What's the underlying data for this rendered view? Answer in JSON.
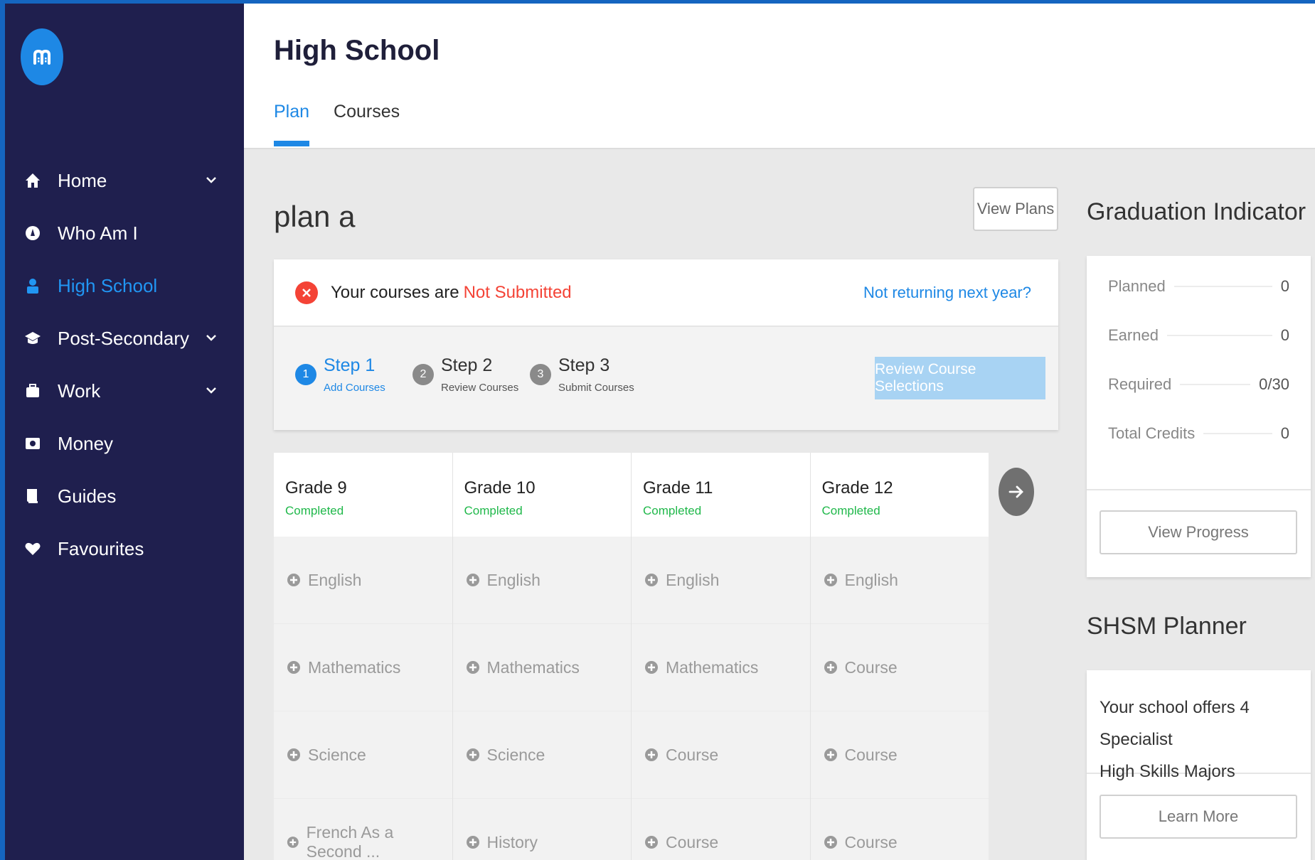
{
  "colors": {
    "sidebar_bg": "#1f1f4e",
    "accent": "#1e88e5",
    "error": "#f44336",
    "success": "#1fb84a"
  },
  "sidebar": {
    "logo_icon": "myblueprint-logo",
    "items": [
      {
        "label": "Home",
        "icon": "home-icon",
        "has_chevron": true
      },
      {
        "label": "Who Am I",
        "icon": "compass-icon",
        "has_chevron": false
      },
      {
        "label": "High School",
        "icon": "student-icon",
        "has_chevron": false,
        "active": true
      },
      {
        "label": "Post-Secondary",
        "icon": "graduation-cap-icon",
        "has_chevron": true
      },
      {
        "label": "Work",
        "icon": "briefcase-icon",
        "has_chevron": true
      },
      {
        "label": "Money",
        "icon": "money-icon",
        "has_chevron": false
      },
      {
        "label": "Guides",
        "icon": "book-icon",
        "has_chevron": false
      },
      {
        "label": "Favourites",
        "icon": "heart-icon",
        "has_chevron": false
      }
    ]
  },
  "header": {
    "title": "High School",
    "tabs": [
      {
        "label": "Plan",
        "active": true
      },
      {
        "label": "Courses",
        "active": false
      }
    ]
  },
  "plan": {
    "name": "plan a",
    "view_plans_label": "View Plans",
    "status_prefix": "Your courses are",
    "status_value": "Not Submitted",
    "not_returning_link": "Not returning next year?",
    "steps": [
      {
        "num": "1",
        "title": "Step 1",
        "sub": "Add Courses",
        "active": true
      },
      {
        "num": "2",
        "title": "Step 2",
        "sub": "Review Courses",
        "active": false
      },
      {
        "num": "3",
        "title": "Step 3",
        "sub": "Submit Courses",
        "active": false
      }
    ],
    "review_button": "Review Course Selections"
  },
  "grades": [
    {
      "title": "Grade 9",
      "status": "Completed",
      "courses": [
        "English",
        "Mathematics",
        "Science",
        "French As a Second ..."
      ]
    },
    {
      "title": "Grade 10",
      "status": "Completed",
      "courses": [
        "English",
        "Mathematics",
        "Science",
        "History"
      ]
    },
    {
      "title": "Grade 11",
      "status": "Completed",
      "courses": [
        "English",
        "Mathematics",
        "Course",
        "Course"
      ]
    },
    {
      "title": "Grade 12",
      "status": "Completed",
      "courses": [
        "English",
        "Course",
        "Course",
        "Course"
      ]
    }
  ],
  "graduation": {
    "title": "Graduation Indicator",
    "rows": [
      {
        "label": "Planned",
        "value": "0"
      },
      {
        "label": "Earned",
        "value": "0"
      },
      {
        "label": "Required",
        "value": "0/30"
      },
      {
        "label": "Total Credits",
        "value": "0"
      }
    ],
    "button": "View Progress"
  },
  "shsm": {
    "title": "SHSM Planner",
    "line1": "Your school offers 4 Specialist",
    "line2": "High Skills Majors",
    "button": "Learn More"
  }
}
